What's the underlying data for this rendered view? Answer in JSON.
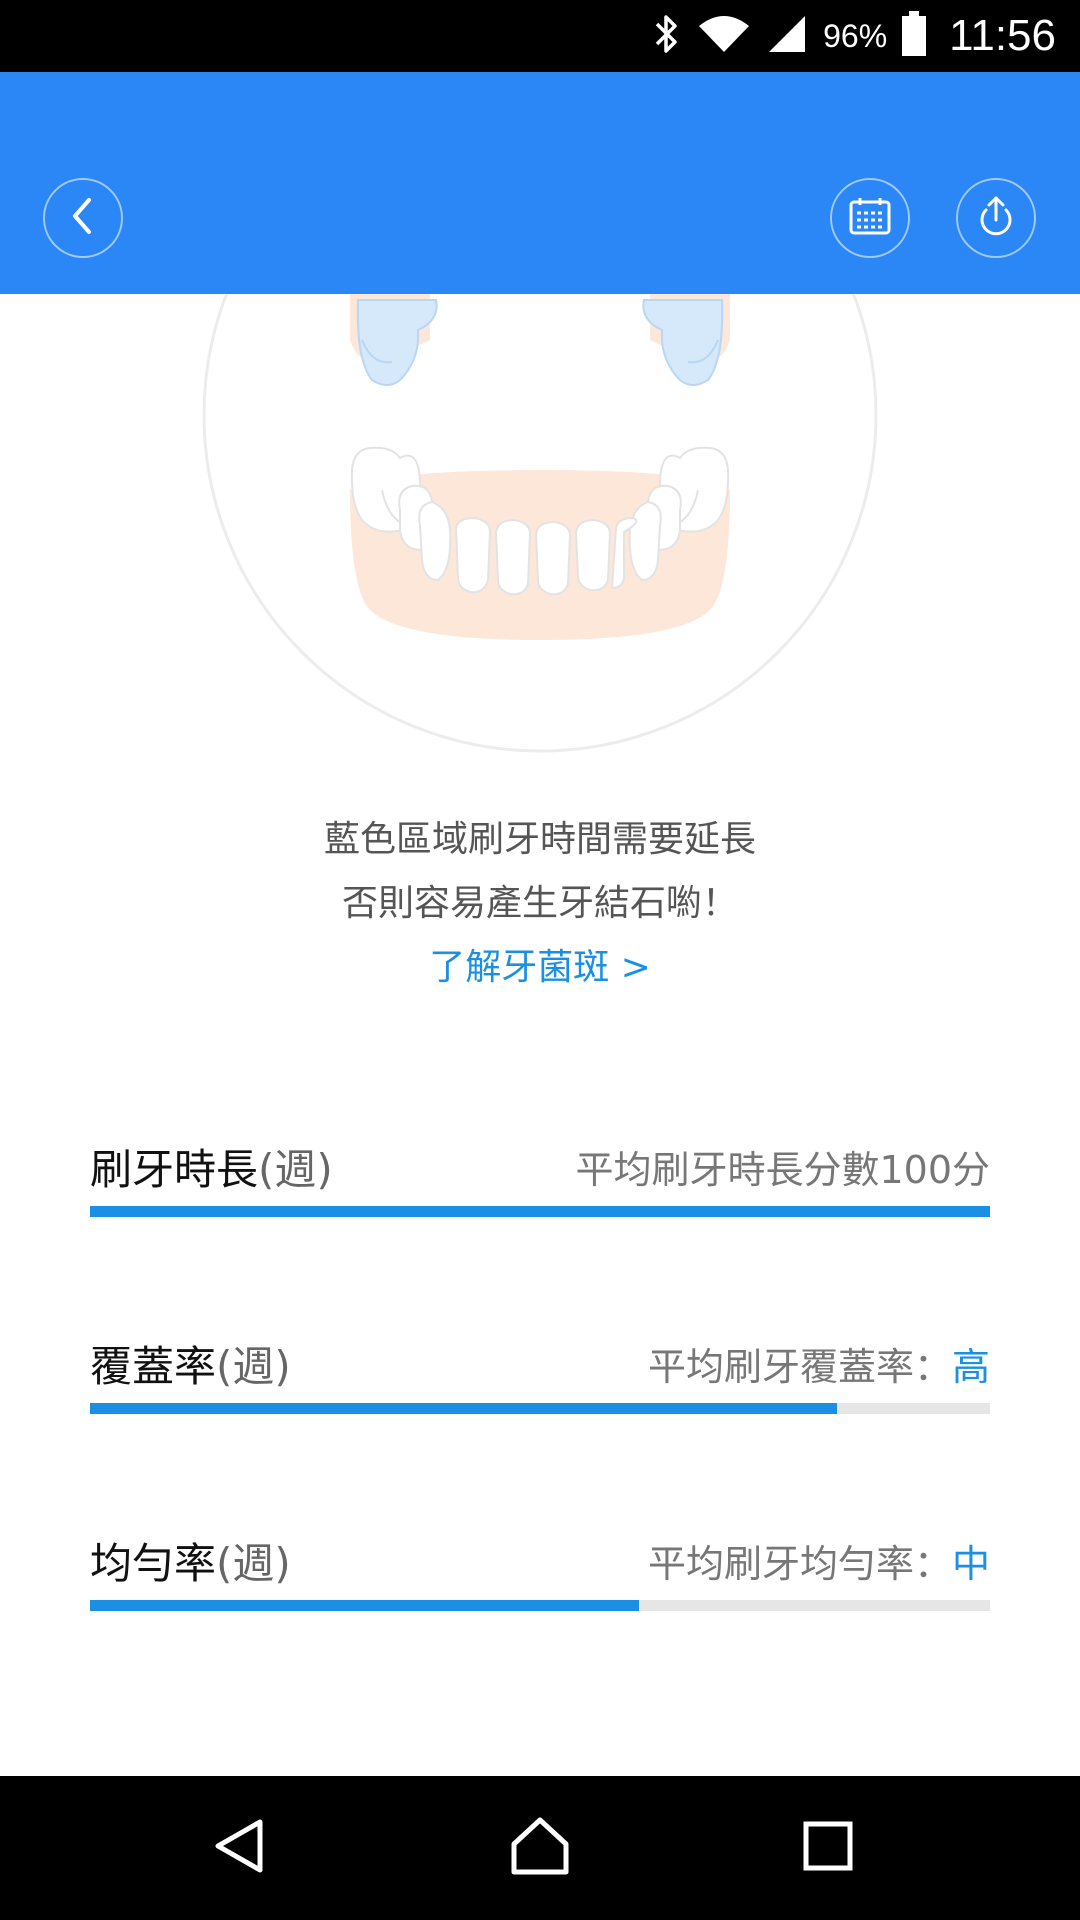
{
  "theme": {
    "accent": "#2a87f5",
    "link": "#1a8fe3",
    "progress": "#1a8fe3"
  },
  "status_bar": {
    "battery": "96%",
    "time": "11:56",
    "icons": [
      "bluetooth-icon",
      "wifi-icon",
      "signal-icon",
      "battery-icon"
    ]
  },
  "header": {
    "back_icon": "back-arrow-icon",
    "calendar_icon": "calendar-icon",
    "share_icon": "upload-icon"
  },
  "tip": {
    "line1": "藍色區域刷牙時間需要延長",
    "line2": "否則容易產生牙結石喲！",
    "link": "了解牙菌斑 >"
  },
  "metrics": [
    {
      "label": "刷牙時長",
      "period": "(週)",
      "summary": "平均刷牙時長分數100分",
      "level": "",
      "progress": 1.0
    },
    {
      "label": "覆蓋率",
      "period": "(週)",
      "summary": "平均刷牙覆蓋率：",
      "level": "高",
      "progress": 0.83
    },
    {
      "label": "均勻率",
      "period": "(週)",
      "summary": "平均刷牙均勻率：",
      "level": "中",
      "progress": 0.61
    }
  ],
  "nav_bar": {
    "back_icon": "nav-back-icon",
    "home_icon": "nav-home-icon",
    "recent_icon": "nav-recent-icon"
  }
}
